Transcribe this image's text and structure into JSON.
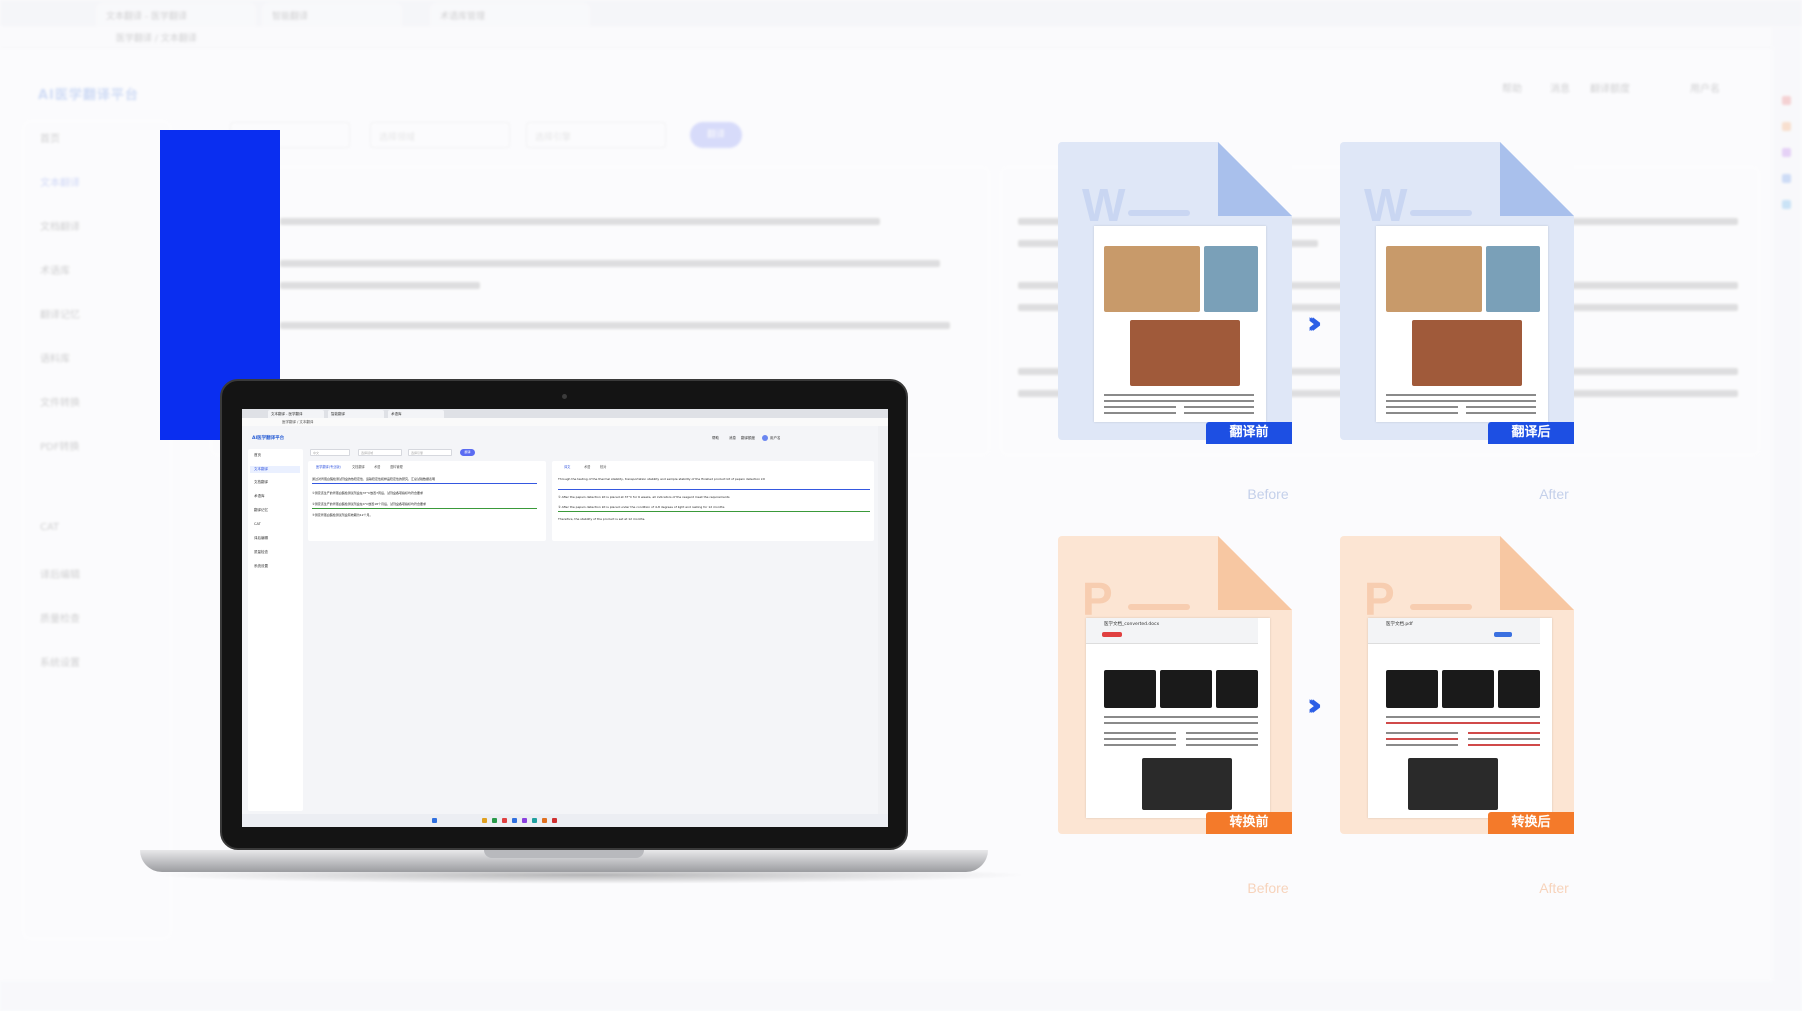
{
  "background_app": {
    "tabs": [
      "文本翻译 - 医学翻译",
      "智能翻译",
      "术语库管理"
    ],
    "address": "医学翻译 / 文本翻译",
    "logo": "AI医学翻译平台",
    "sidebar_items": [
      "首页",
      "文本翻译",
      "文档翻译",
      "术语库",
      "翻译记忆",
      "语料库",
      "文件转换",
      "PDF转换",
      "CAT",
      "译后编辑",
      "质量检查",
      "系统设置"
    ],
    "top_right": [
      "帮助",
      "消息",
      "翻译额度",
      "用户名"
    ],
    "filters": [
      "选择语言",
      "选择领域",
      "选择引擎"
    ],
    "go_label": "翻译"
  },
  "laptop_screen": {
    "tabs": [
      "文本翻译 - 医学翻译",
      "智能翻译",
      "术语库"
    ],
    "address": "医学翻译 / 文本翻译",
    "logo": "AI医学翻译平台",
    "sidebar_items": [
      "首页",
      "文本翻译",
      "文档翻译",
      "术语库",
      "翻译记忆",
      "CAT",
      "译后编辑",
      "质量检查",
      "系统设置"
    ],
    "top_right": [
      "帮助",
      "消息",
      "翻译额度",
      "用户名"
    ],
    "filters": [
      "中文",
      "选择领域",
      "选择引擎"
    ],
    "go_label": "翻译",
    "left_tabs": [
      "医学翻译(专业版)",
      "文档翻译",
      "术语",
      "语料管理"
    ],
    "right_tabs": [
      "译文",
      "术语",
      "校对"
    ],
    "source_lines": [
      "通过对胃蛋白酶检测试剂盒的热稳定性、运输稳定性和样品稳定性的研究，汇总试验数据表明",
      "①测定该生产的胃蛋白酶检测试剂盒在37°C放置7周后，试剂盒各项指标均符合要求",
      "②测定该生产的胃蛋白酶检测试剂盒在4°C放置18个月后，试剂盒各项指标均符合要求",
      "③测定胃蛋白酶检测试剂盒有效期为12个月。"
    ],
    "target_lines": [
      "Through the testing of the thermal stability, transportation stability and sample stability of the finished product kit of pepsin detection kit",
      "① After the pepsin detection kit is placed at 37°C for 6 weeks, all indicators of the reagent meet the requirements",
      "② After the pepsin detection kit is placed under the condition of 4-8 degrees of light and resting for 12 months",
      "Therefore, the stability of the product is set at 12 months."
    ]
  },
  "cards": {
    "translate_before": {
      "badge": "翻译前",
      "caption": "Before",
      "letter": "W"
    },
    "translate_after": {
      "badge": "翻译后",
      "caption": "After",
      "letter": "W"
    },
    "convert_before": {
      "badge": "转换前",
      "caption": "Before",
      "letter": "P",
      "filename": "医学文档_converted.docx"
    },
    "convert_after": {
      "badge": "转换后",
      "caption": "After",
      "letter": "P",
      "filename": "医学文档.pdf"
    }
  },
  "colors": {
    "accent": "#0a2ef0",
    "blue_card": "#dfe7f7",
    "orange_card": "#fce5d3",
    "blue_badge": "#1d4fe3",
    "orange_badge": "#f47a2a"
  },
  "icons": [
    "double-chevron-right-icon"
  ]
}
